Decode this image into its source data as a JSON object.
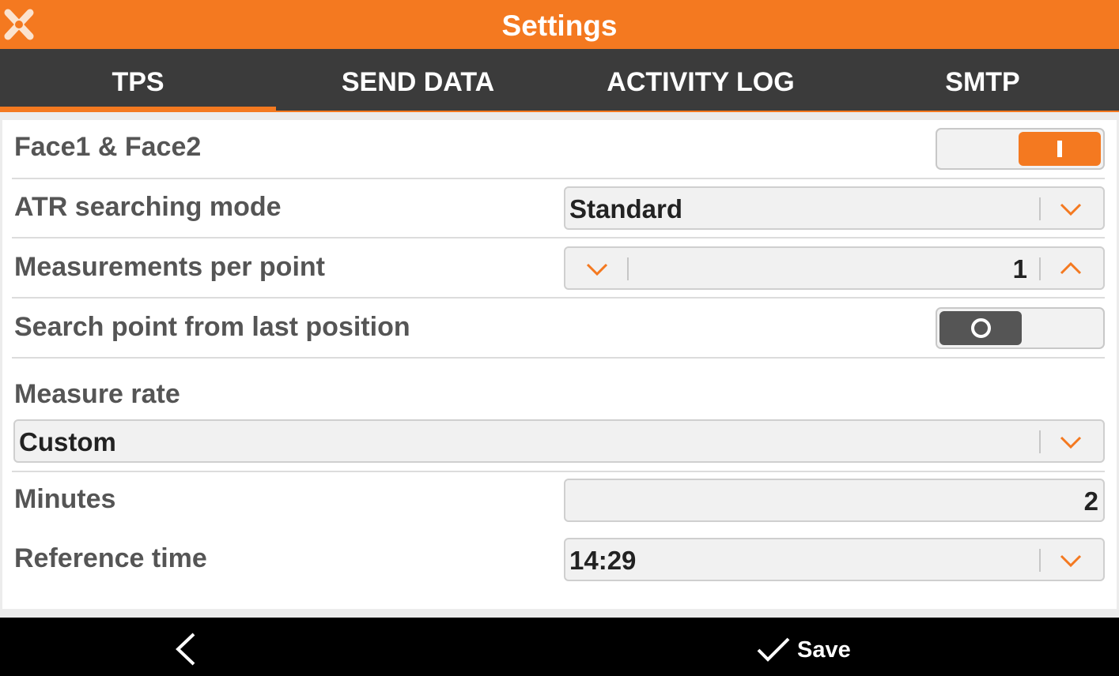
{
  "header": {
    "title": "Settings",
    "logo_icon": "app-logo-icon"
  },
  "tabs": [
    {
      "label": "TPS",
      "active": true
    },
    {
      "label": "SEND DATA",
      "active": false
    },
    {
      "label": "ACTIVITY LOG",
      "active": false
    },
    {
      "label": "SMTP",
      "active": false
    }
  ],
  "settings": {
    "face": {
      "label": "Face1 & Face2",
      "enabled": true
    },
    "atr": {
      "label": "ATR searching mode",
      "value": "Standard"
    },
    "measurements": {
      "label": "Measurements per point",
      "value": "1"
    },
    "search_last": {
      "label": "Search point from last position",
      "enabled": false
    },
    "measure_rate": {
      "label": "Measure rate",
      "value": "Custom"
    },
    "minutes": {
      "label": "Minutes",
      "value": "2"
    },
    "reference_time": {
      "label": "Reference time",
      "value": "14:29"
    }
  },
  "footer": {
    "back_icon": "chevron-left-icon",
    "save_label": "Save",
    "save_icon": "checkmark-icon"
  },
  "colors": {
    "accent": "#f47920",
    "tab_bar": "#3b3b3b",
    "bottom_bar": "#000000"
  }
}
